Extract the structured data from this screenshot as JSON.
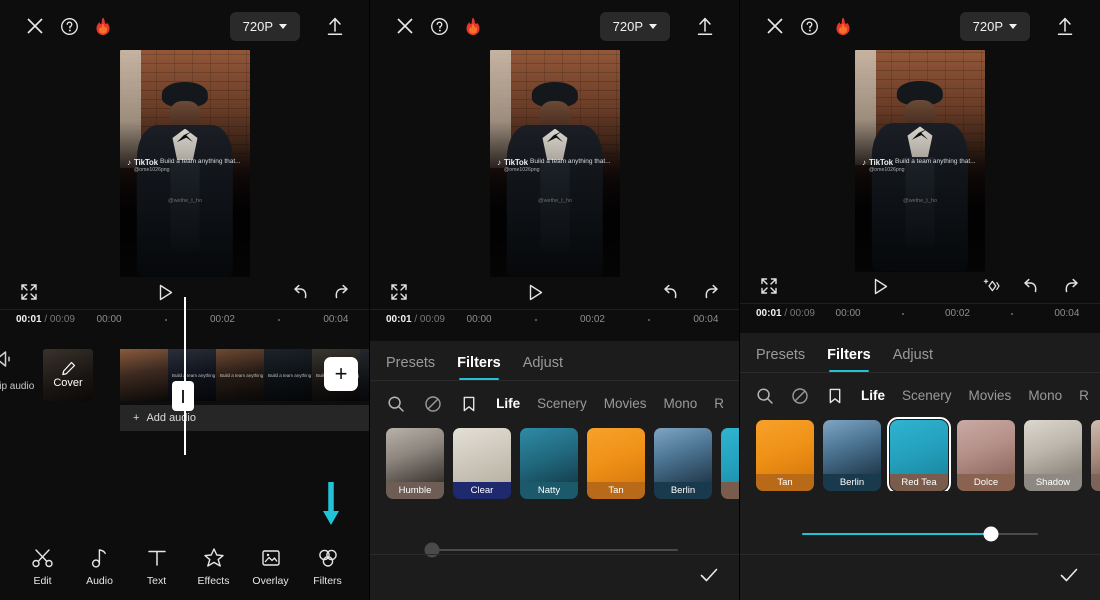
{
  "app": {
    "topbar": {
      "close_icon": "close-icon",
      "help_icon": "help-icon",
      "flame_icon": "flame-icon",
      "resolution": "720P",
      "export_icon": "export-icon"
    },
    "player": {
      "fullscreen_icon": "fullscreen-icon",
      "play_icon": "play-icon",
      "compare_icon": "compare-icon",
      "undo_icon": "undo-icon",
      "redo_icon": "redo-icon"
    },
    "timeline": {
      "current_time": "00:01",
      "separator": "/",
      "total_time": "00:09",
      "ticks": [
        "00:00",
        "00:02",
        "00:04"
      ],
      "cover_label": "Cover",
      "clip_audio_label": "clip audio",
      "add_audio_label": "Add audio",
      "add_clip_label": "+"
    },
    "toolbar": {
      "items": [
        {
          "label": "Edit",
          "icon": "scissors-icon"
        },
        {
          "label": "Audio",
          "icon": "music-note-icon"
        },
        {
          "label": "Text",
          "icon": "text-icon"
        },
        {
          "label": "Effects",
          "icon": "sparkle-star-icon"
        },
        {
          "label": "Overlay",
          "icon": "image-overlay-icon"
        },
        {
          "label": "Filters",
          "icon": "filters-circles-icon"
        }
      ],
      "highlight_target": "Filters",
      "arrow_color": "#22c3d6"
    },
    "video_overlay": {
      "brand": "TikTok",
      "handle": "@ome1026png",
      "caption": "Build a team anything that...",
      "center_watermark": "@wethe_t_ho"
    }
  },
  "filter_sheet": {
    "tabs": [
      {
        "label": "Presets",
        "active": false
      },
      {
        "label": "Filters",
        "active": true
      },
      {
        "label": "Adjust",
        "active": false
      }
    ],
    "category_icons": [
      "search-icon",
      "none-icon",
      "bookmark-icon"
    ],
    "categories": [
      {
        "label": "Life",
        "active": true
      },
      {
        "label": "Scenery",
        "active": false
      },
      {
        "label": "Movies",
        "active": false
      },
      {
        "label": "Mono",
        "active": false
      },
      {
        "label": "R",
        "active": false
      }
    ],
    "confirm_icon": "check-icon",
    "accent_color": "#22c3d6"
  },
  "panel2": {
    "filters": [
      {
        "name": "Humble",
        "label_bg": "#6d5d55",
        "img": "linear-gradient(160deg,#b9b2ab 0%,#8d857e 45%,#3b3530 100%)"
      },
      {
        "name": "Clear",
        "label_bg": "#1f2a6e",
        "img": "linear-gradient(160deg,#e4e0d6 0%,#cfc9bd 50%,#b9b3a6 100%)"
      },
      {
        "name": "Natty",
        "label_bg": "#1c5a6b",
        "img": "linear-gradient(160deg,#2e8ba6 0%,#21677d 55%,#14414f 100%)"
      },
      {
        "name": "Tan",
        "label_bg": "#b86a18",
        "img": "linear-gradient(160deg,#f7a12a 0%,#ef9117 55%,#d97c0d 100%)"
      },
      {
        "name": "Berlin",
        "label_bg": "#19394d",
        "img": "linear-gradient(160deg,#7fa6c4 0%,#4d7694 45%,#22394c 100%)"
      }
    ],
    "slider": {
      "value": 0,
      "active": false
    }
  },
  "panel3": {
    "filters": [
      {
        "name": "Tan",
        "label_bg": "#b86a18",
        "img": "linear-gradient(160deg,#f7a12a 0%,#ef9117 55%,#d97c0d 100%)",
        "selected": false
      },
      {
        "name": "Berlin",
        "label_bg": "#19394d",
        "img": "linear-gradient(160deg,#7fa6c4 0%,#4d7694 45%,#22394c 100%)",
        "selected": false
      },
      {
        "name": "Red Tea",
        "label_bg": "#7a5c4c",
        "img": "linear-gradient(160deg,#2fb4cf 0%,#24a0bd 55%,#1b8aa4 100%)",
        "selected": true
      },
      {
        "name": "Dolce",
        "label_bg": "#8a6250",
        "img": "linear-gradient(160deg,#c9aaa4 0%,#b59089 50%,#8e6a63 100%)",
        "selected": false
      },
      {
        "name": "Shadow",
        "label_bg": "#8d8982",
        "img": "linear-gradient(160deg,#ddd8cf 0%,#bcb6ac 50%,#8b857c 100%)",
        "selected": false
      }
    ],
    "slider": {
      "value": 80,
      "active": true
    }
  }
}
